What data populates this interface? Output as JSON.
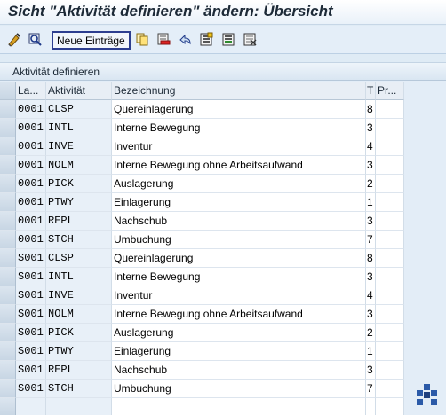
{
  "window": {
    "title": "Sicht \"Aktivität definieren\" ändern: Übersicht"
  },
  "toolbar": {
    "new_entries_label": "Neue Einträge",
    "icons": [
      "edit-glasses-icon",
      "display-change-icon",
      "copy-icon",
      "delete-icon",
      "undo-icon",
      "select-all-icon",
      "select-block-icon",
      "deselect-all-icon"
    ]
  },
  "section": {
    "title": "Aktivität definieren"
  },
  "table": {
    "columns": [
      "La...",
      "Aktivität",
      "Bezeichnung",
      "T",
      "Pr..."
    ],
    "rows": [
      {
        "la": "0001",
        "act": "CLSP",
        "bez": "Quereinlagerung",
        "t": "8",
        "pr": ""
      },
      {
        "la": "0001",
        "act": "INTL",
        "bez": "Interne Bewegung",
        "t": "3",
        "pr": ""
      },
      {
        "la": "0001",
        "act": "INVE",
        "bez": "Inventur",
        "t": "4",
        "pr": ""
      },
      {
        "la": "0001",
        "act": "NOLM",
        "bez": "Interne Bewegung ohne Arbeitsaufwand",
        "t": "3",
        "pr": ""
      },
      {
        "la": "0001",
        "act": "PICK",
        "bez": "Auslagerung",
        "t": "2",
        "pr": ""
      },
      {
        "la": "0001",
        "act": "PTWY",
        "bez": "Einlagerung",
        "t": "1",
        "pr": ""
      },
      {
        "la": "0001",
        "act": "REPL",
        "bez": "Nachschub",
        "t": "3",
        "pr": ""
      },
      {
        "la": "0001",
        "act": "STCH",
        "bez": "Umbuchung",
        "t": "7",
        "pr": ""
      },
      {
        "la": "S001",
        "act": "CLSP",
        "bez": "Quereinlagerung",
        "t": "8",
        "pr": ""
      },
      {
        "la": "S001",
        "act": "INTL",
        "bez": "Interne Bewegung",
        "t": "3",
        "pr": ""
      },
      {
        "la": "S001",
        "act": "INVE",
        "bez": "Inventur",
        "t": "4",
        "pr": ""
      },
      {
        "la": "S001",
        "act": "NOLM",
        "bez": "Interne Bewegung ohne Arbeitsaufwand",
        "t": "3",
        "pr": ""
      },
      {
        "la": "S001",
        "act": "PICK",
        "bez": "Auslagerung",
        "t": "2",
        "pr": ""
      },
      {
        "la": "S001",
        "act": "PTWY",
        "bez": "Einlagerung",
        "t": "1",
        "pr": ""
      },
      {
        "la": "S001",
        "act": "REPL",
        "bez": "Nachschub",
        "t": "3",
        "pr": ""
      },
      {
        "la": "S001",
        "act": "STCH",
        "bez": "Umbuchung",
        "t": "7",
        "pr": ""
      }
    ]
  },
  "colors": {
    "accent": "#2d3e8f",
    "background": "#dfebf5",
    "header_bg": "#e8eef5",
    "key_cell_bg": "#e8f0f8"
  }
}
